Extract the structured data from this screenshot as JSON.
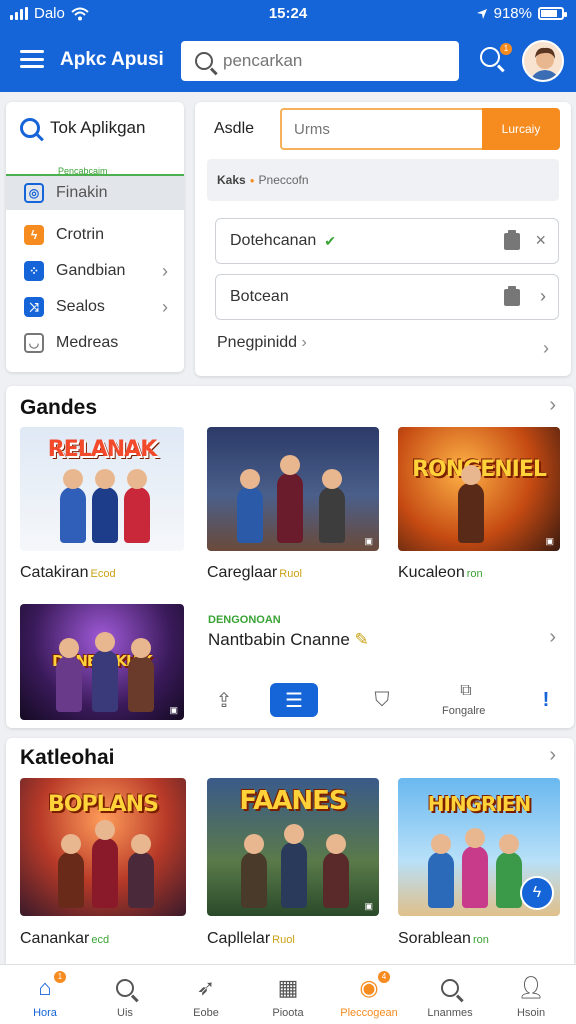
{
  "status": {
    "carrier": "Dalo",
    "time": "15:24",
    "battery": "918%"
  },
  "appbar": {
    "title": "Apkc Apusi",
    "search_placeholder": "pencarkan",
    "notification_count": "1"
  },
  "sidebar": {
    "title": "Tok Aplikgan",
    "tag": "Pencabcaim",
    "items": [
      {
        "label": "Finakin",
        "icon": "app-store-icon",
        "color": "#1565d8",
        "active": true
      },
      {
        "label": "Crotrin",
        "icon": "bolt-icon",
        "color": "#f68b1f"
      },
      {
        "label": "Gandbian",
        "icon": "grid-icon",
        "color": "#1565d8"
      },
      {
        "label": "Sealos",
        "icon": "share-icon",
        "color": "#1565d8"
      },
      {
        "label": "Medreas",
        "icon": "chat-icon",
        "color": "#777777"
      }
    ]
  },
  "main": {
    "label": "Asdle",
    "input_placeholder": "Urms",
    "button_label": "Lurcaiy",
    "filter_chip": "Kaks",
    "filter_text": "Pneccofn",
    "rows": [
      {
        "label": "Dotehcanan",
        "end": "×"
      },
      {
        "label": "Botcean",
        "end": "›"
      }
    ],
    "link_label": "Pnegpinidd",
    "link_chevron": "›"
  },
  "games_section": {
    "title": "Gandes",
    "chevron": "›",
    "items": [
      {
        "name": "Catakiran",
        "sub": "Ecod",
        "banner": "RELANAK",
        "sub_style": "gold"
      },
      {
        "name": "Careglaar",
        "sub": "Ruol",
        "banner": "",
        "sub_style": "gold"
      },
      {
        "name": "Kucaleon",
        "sub": "ron",
        "banner": "RONGENIEL",
        "sub_style": "green"
      },
      {
        "name": "",
        "sub": "",
        "banner": "DONEECKIAK",
        "sub_style": "gold"
      }
    ],
    "feature": {
      "tag": "DENGONOAN",
      "title": "Nantbabin Cnanne",
      "chevron": "›"
    },
    "toolbar": {
      "label_right": "Fongalre"
    }
  },
  "category_section": {
    "title": "Katleohai",
    "chevron": "›",
    "items": [
      {
        "name": "Canankar",
        "sub": "ecd",
        "banner": "BOPLANS",
        "sub_style": "green"
      },
      {
        "name": "Capllelar",
        "sub": "Ruol",
        "banner": "FAANES",
        "sub_style": "gold"
      },
      {
        "name": "Sorablean",
        "sub": "ron",
        "banner": "HINGRIEN",
        "sub_style": "green"
      }
    ]
  },
  "bottom_nav": [
    {
      "label": "Hora",
      "icon": "home-icon",
      "state": "active",
      "badge": "1"
    },
    {
      "label": "Uis",
      "icon": "search-icon",
      "state": ""
    },
    {
      "label": "Eobe",
      "icon": "rocket-icon",
      "state": ""
    },
    {
      "label": "Pioota",
      "icon": "grid-icon",
      "state": ""
    },
    {
      "label": "Pleccogean",
      "icon": "game-icon",
      "state": "orange",
      "badge": "4"
    },
    {
      "label": "Lnanmes",
      "icon": "profile-search-icon",
      "state": ""
    },
    {
      "label": "Hsoin",
      "icon": "person-icon",
      "state": ""
    }
  ]
}
